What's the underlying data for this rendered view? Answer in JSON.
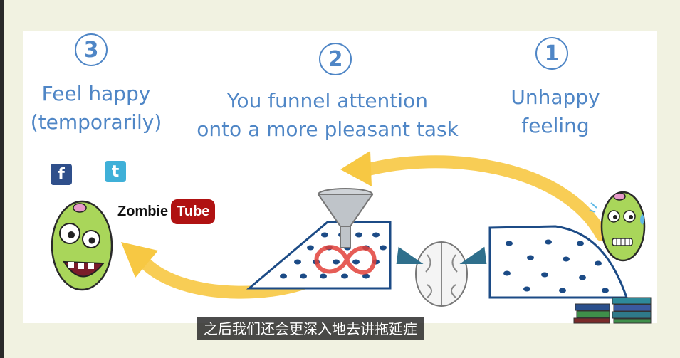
{
  "steps": [
    {
      "number": "3",
      "label_line1": "Feel happy",
      "label_line2": "(temporarily)"
    },
    {
      "number": "2",
      "label_line1": "You funnel attention",
      "label_line2": "onto a more pleasant task"
    },
    {
      "number": "1",
      "label_line1": "Unhappy",
      "label_line2": "feeling"
    }
  ],
  "stickers": {
    "facebook": "f",
    "twitter": "t"
  },
  "zombietube": {
    "zombie": "Zombie",
    "tube": "Tube"
  },
  "caption": "之后我们还会更深入地去讲拖延症",
  "colors": {
    "accent": "#4f86c6",
    "arrow": "#f7c843",
    "dots": "#1c4b86",
    "red_loop": "#e2413a"
  },
  "icons": [
    "facebook-icon",
    "twitter-icon",
    "funnel-icon",
    "brain-icon",
    "happy-zombie",
    "worried-zombie",
    "book-stack"
  ]
}
